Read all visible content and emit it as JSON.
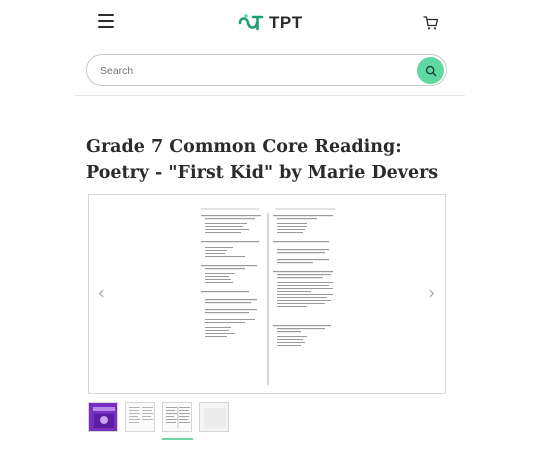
{
  "header": {
    "logo_text": "TPT",
    "brand_color": "#1f9e74",
    "accent_color": "#5fd8a2",
    "menu_icon": "hamburger-icon",
    "cart_icon": "cart-icon"
  },
  "search": {
    "placeholder": "Search",
    "value": "",
    "button_icon": "search-icon"
  },
  "product": {
    "title": "Grade 7 Common Core Reading: Poetry - \"First Kid\" by Marie Devers"
  },
  "preview": {
    "prev_icon": "chevron-left-icon",
    "next_icon": "chevron-right-icon",
    "thumbnails": [
      {
        "name": "cover",
        "selected": false
      },
      {
        "name": "page-1",
        "selected": false
      },
      {
        "name": "page-2",
        "selected": true
      },
      {
        "name": "page-3",
        "selected": false
      }
    ]
  }
}
